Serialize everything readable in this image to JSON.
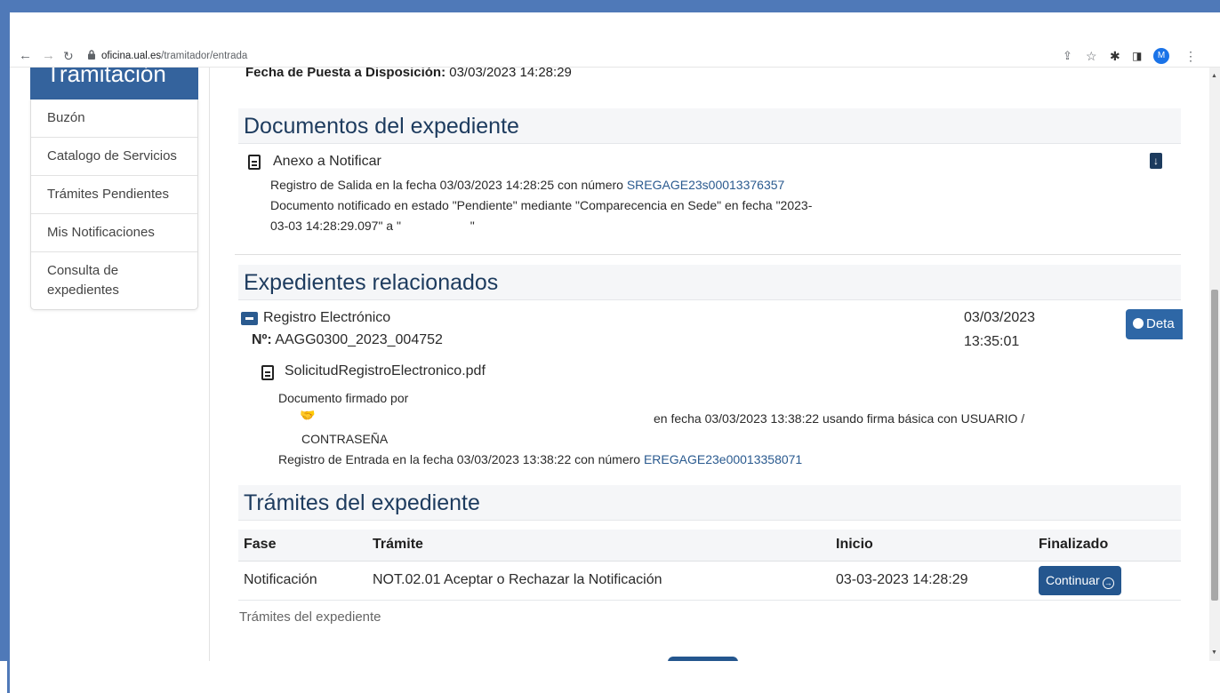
{
  "browser": {
    "url_host": "oficina.ual.es",
    "url_path": "/tramitador/entrada",
    "avatar_letter": "M"
  },
  "sidebar": {
    "header": "Tramitación",
    "items": [
      {
        "label": "Buzón"
      },
      {
        "label": "Catalogo de Servicios"
      },
      {
        "label": "Trámites Pendientes"
      },
      {
        "label": "Mis Notificaciones"
      },
      {
        "label": "Consulta de expedientes"
      }
    ]
  },
  "fecha_puesta": {
    "label": "Fecha de Puesta a Disposición:",
    "value": "03/03/2023 14:28:29"
  },
  "documentos": {
    "title": "Documentos del expediente",
    "doc_name": "Anexo a Notificar",
    "registro_text": "Registro de Salida en la fecha 03/03/2023 14:28:25 con número",
    "registro_num": "SREGAGE23s00013376357",
    "estado_line1": "Documento notificado en estado \"Pendiente\" mediante \"Comparecencia en Sede\" en fecha \"2023-",
    "estado_line2": "03-03 14:28:29.097\" a \"                    \""
  },
  "relacionados": {
    "title": "Expedientes relacionados",
    "exp_name": "Registro Electrónico",
    "num_label": "Nº:",
    "num_value": "AAGG0300_2023_004752",
    "date": "03/03/2023",
    "time": "13:35:01",
    "detail_btn": "Deta",
    "pdf_name": "SolicitudRegistroElectronico.pdf",
    "firmado_por": "Documento firmado por",
    "firma_text": "en fecha 03/03/2023 13:38:22  usando firma básica con  USUARIO /",
    "firma_text2": "CONTRASEÑA",
    "registro_text": "Registro de Entrada en la fecha 03/03/2023 13:38:22 con número",
    "registro_num": "EREGAGE23e00013358071"
  },
  "tramites": {
    "title": "Trámites del expediente",
    "headers": [
      "Fase",
      "Trámite",
      "Inicio",
      "Finalizado"
    ],
    "rows": [
      {
        "fase": "Notificación",
        "tramite": "NOT.02.01 Aceptar o Rechazar la Notificación",
        "inicio": "03-03-2023 14:28:29",
        "button": "Continuar"
      }
    ],
    "footer": "Trámites del expediente"
  }
}
